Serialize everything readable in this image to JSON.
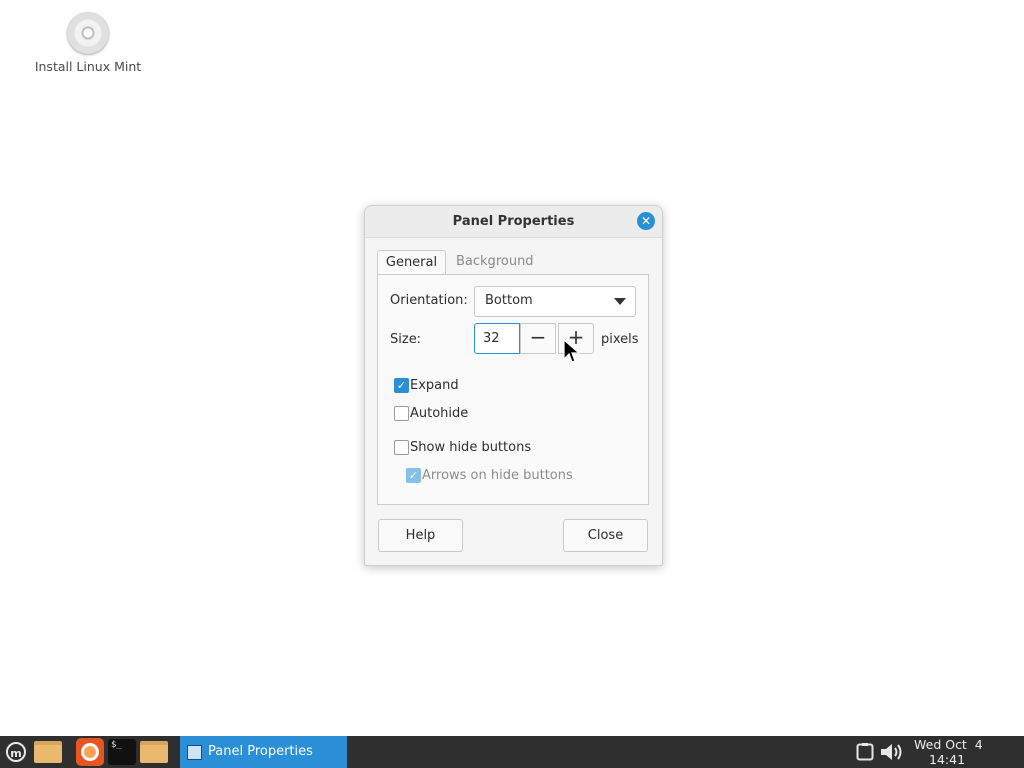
{
  "desktop": {
    "icons": [
      {
        "label": "Install Linux Mint",
        "icon": "cd-icon"
      }
    ]
  },
  "dialog": {
    "title": "Panel Properties",
    "tabs": [
      {
        "label": "General",
        "active": true
      },
      {
        "label": "Background",
        "active": false
      }
    ],
    "orientation": {
      "label": "Orientation:",
      "value": "Bottom"
    },
    "size": {
      "label": "Size:",
      "value": "32",
      "unit": "pixels"
    },
    "checkboxes": [
      {
        "label": "Expand",
        "checked": true,
        "enabled": true
      },
      {
        "label": "Autohide",
        "checked": false,
        "enabled": true
      },
      {
        "label": "Show hide buttons",
        "checked": false,
        "enabled": true
      },
      {
        "label": "Arrows on hide buttons",
        "checked": true,
        "enabled": false
      }
    ],
    "buttons": {
      "help": "Help",
      "close": "Close"
    }
  },
  "taskbar": {
    "launchers": [
      "mint-menu-icon",
      "folder-icon",
      "firefox-icon",
      "terminal-icon",
      "files-icon"
    ],
    "window_button": "Panel Properties",
    "clock": {
      "date": "Wed Oct  4",
      "time": "14:41"
    }
  },
  "colors": {
    "accent": "#2a8fd6",
    "panel": "#2f2f2f"
  }
}
